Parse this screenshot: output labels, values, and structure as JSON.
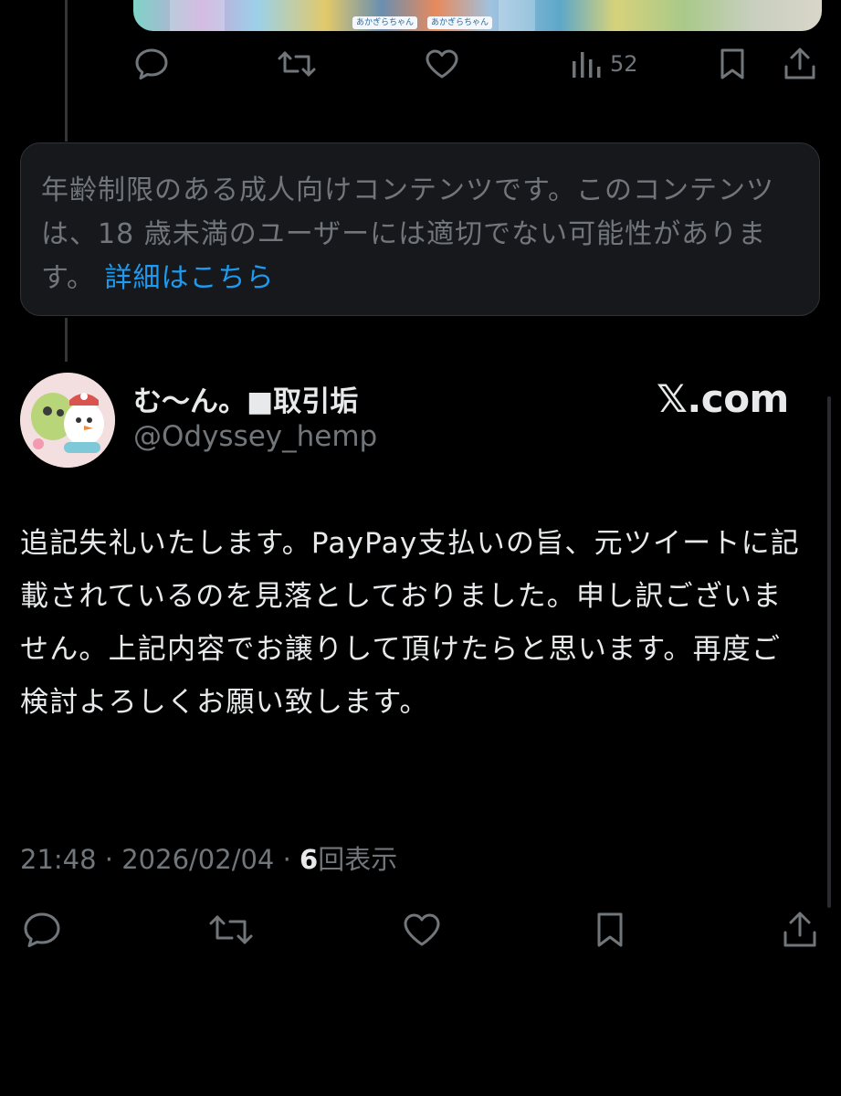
{
  "colors": {
    "background": "#000000",
    "text_primary": "#e7e9ea",
    "text_secondary": "#71767b",
    "accent_link": "#1d9bf0",
    "card_bg": "#16181c",
    "border": "#2f3336"
  },
  "parent_tweet": {
    "media_labels": [
      "あかぎらちゃん",
      "あかぎらちゃん"
    ],
    "actions": {
      "reply_icon": "reply-icon",
      "retweet_icon": "retweet-icon",
      "like_icon": "heart-icon",
      "views_icon": "views-bar-icon",
      "views_count": "52",
      "bookmark_icon": "bookmark-icon",
      "share_icon": "share-icon"
    }
  },
  "age_notice": {
    "text": "年齢制限のある成人向けコンテンツです。このコンテンツは、18 歳未満のユーザーには適切でない可能性があります。",
    "link_text": "詳細はこちら"
  },
  "tweet": {
    "author": {
      "display_name": "む〜ん。■取引垢",
      "handle": "@Odyssey_hemp",
      "avatar_icon": "avatar-image"
    },
    "source_badge": "𝕏.com",
    "body": "追記失礼いたします。PayPay支払いの旨、元ツイートに記載されているのを見落としておりました。申し訳ございません。上記内容でお譲りして頂けたらと思います。再度ご検討よろしくお願い致します。",
    "meta": {
      "time": "21:48",
      "separator": "·",
      "date": "2026/02/04",
      "views_count": "6",
      "views_label": "回表示"
    },
    "actions": {
      "reply_icon": "reply-icon",
      "retweet_icon": "retweet-icon",
      "like_icon": "heart-icon",
      "bookmark_icon": "bookmark-icon",
      "share_icon": "share-icon"
    }
  }
}
